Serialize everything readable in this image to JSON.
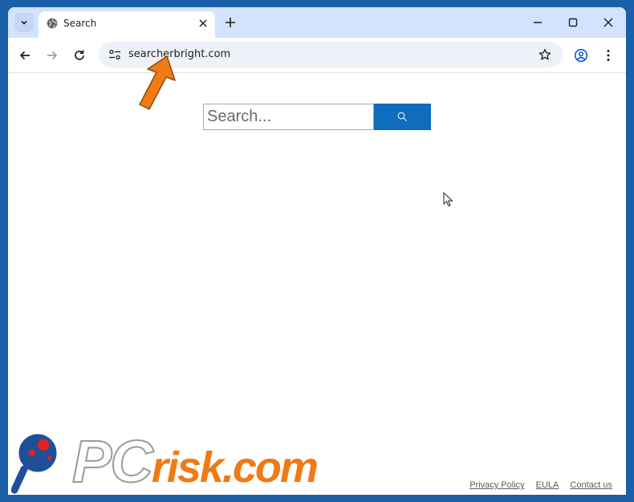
{
  "tab": {
    "title": "Search"
  },
  "omnibox": {
    "url": "searcherbright.com"
  },
  "search": {
    "placeholder": "Search..."
  },
  "footer": {
    "links": [
      "Privacy Policy",
      "EULA",
      "Contact us"
    ]
  },
  "watermark": {
    "pc": "PC",
    "risk": "risk.com"
  },
  "colors": {
    "search_button": "#0e6dbd",
    "tabstrip": "#d3e3fd",
    "arrow": "#f07a14"
  }
}
